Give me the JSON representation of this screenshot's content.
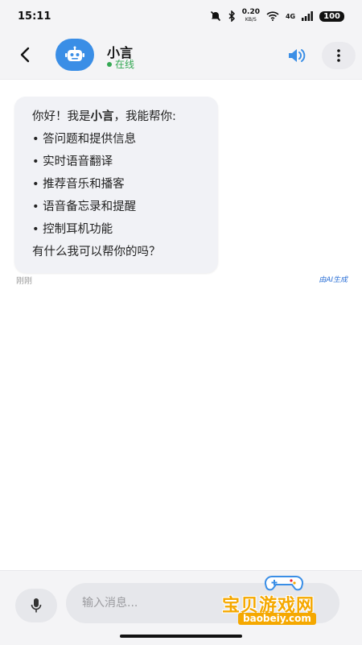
{
  "status": {
    "time": "15:11",
    "speed_value": "0.20",
    "speed_unit": "KB/S",
    "network": "4G",
    "battery": "100"
  },
  "header": {
    "contact_name": "小言",
    "status_text": "在线",
    "icons": {
      "back": "back-arrow-icon",
      "avatar": "robot-icon",
      "speaker": "speaker-icon",
      "more": "more-vertical-icon"
    }
  },
  "message": {
    "greeting_prefix": "你好！我是",
    "greeting_name": "小言",
    "greeting_suffix": "，我能帮你:",
    "items": [
      "答问题和提供信息",
      "实时语音翻译",
      "推荐音乐和播客",
      "语音备忘录和提醒",
      "控制耳机功能"
    ],
    "closing": "有什么我可以帮你的吗？",
    "time_label": "刚刚",
    "ai_label": "由AI生成"
  },
  "input": {
    "placeholder": "输入消息...",
    "mic_icon": "microphone-icon"
  },
  "watermark": {
    "text": "宝贝游戏网",
    "url": "baobeiy.com"
  },
  "colors": {
    "accent": "#3a8ee6",
    "online": "#34a853",
    "ai_label": "#2a6fd6",
    "watermark": "#f5a800"
  }
}
